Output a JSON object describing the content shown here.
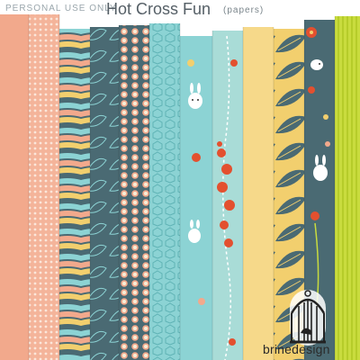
{
  "header": {
    "personal_use": "PERSONAL USE ONLY",
    "title": "Hot Cross Fun",
    "subtitle": "(papers)"
  },
  "brand": {
    "name_part1": "brine",
    "name_part2": "design",
    "logo_icon": "birdcage-icon"
  },
  "colors": {
    "salmon": "#f2a98c",
    "teal": "#4a6a73",
    "aqua": "#8cd3d4",
    "yellow": "#f2cf6e",
    "lime": "#c9dc3e",
    "red": "#e3502f",
    "cream": "#f7efd9"
  }
}
